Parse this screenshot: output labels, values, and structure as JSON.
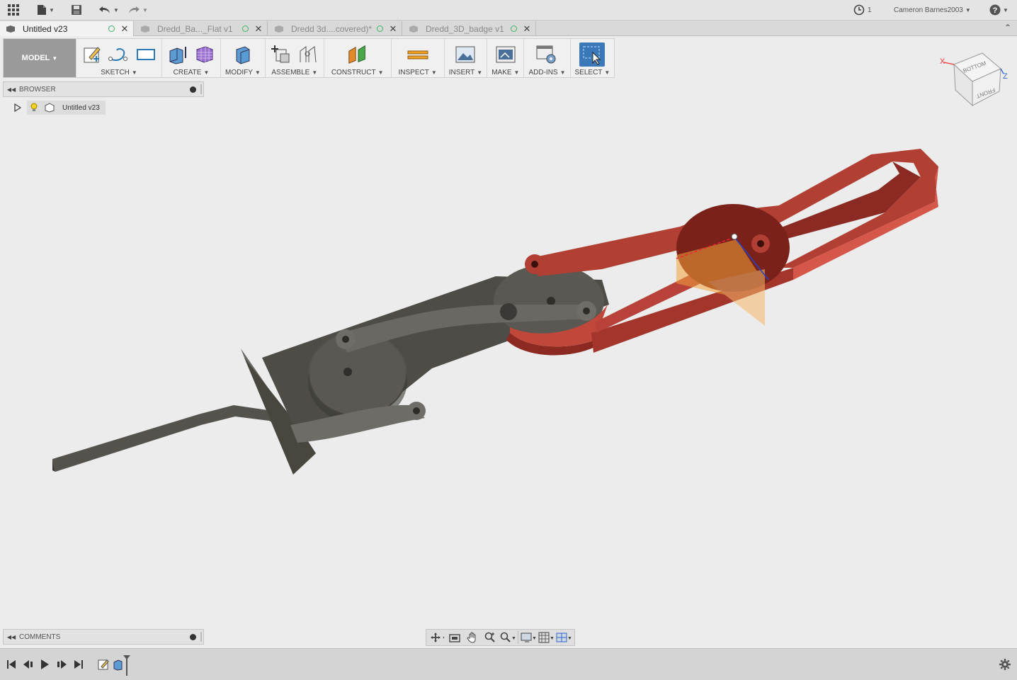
{
  "appbar": {
    "recent_count": "1",
    "user_name": "Cameron Barnes2003"
  },
  "tabs": [
    {
      "label": "Untitled v23"
    },
    {
      "label": "Dredd_Ba..._Flat v1"
    },
    {
      "label": "Dredd 3d....covered)*"
    },
    {
      "label": "Dredd_3D_badge v1"
    }
  ],
  "toolbar": {
    "workspace": "MODEL",
    "groups": [
      "SKETCH",
      "CREATE",
      "MODIFY",
      "ASSEMBLE",
      "CONSTRUCT",
      "INSPECT",
      "INSERT",
      "MAKE",
      "ADD-INS",
      "SELECT"
    ]
  },
  "browser": {
    "title": "BROWSER",
    "root_label": "Untitled v23"
  },
  "comments": {
    "title": "COMMENTS"
  },
  "viewcube": {
    "top_face": "BOTTOM",
    "front_face": "FRONT",
    "axis_x": "X",
    "axis_z": "Z"
  },
  "colors": {
    "select_active": "#3a78b8",
    "component_red": "#b03a2e",
    "component_gray": "#5b5a55",
    "origin_plane": "#f2a33a"
  }
}
